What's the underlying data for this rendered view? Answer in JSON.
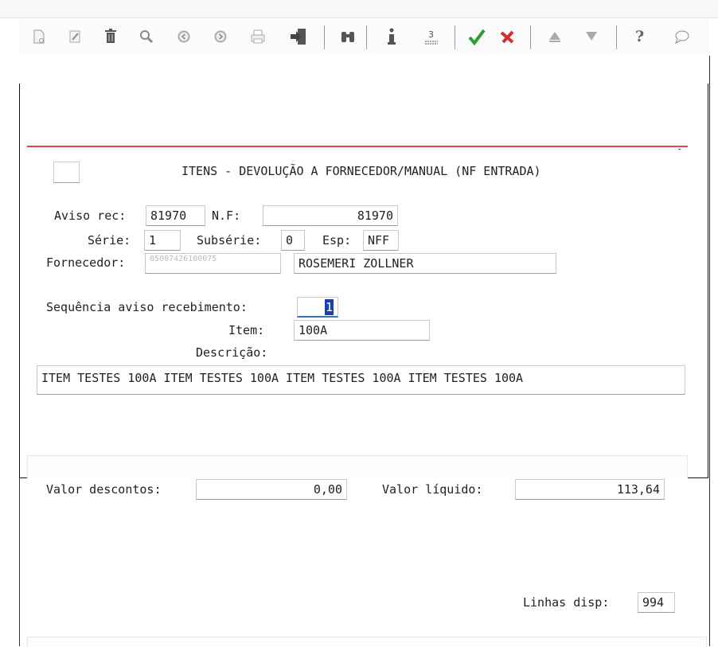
{
  "form": {
    "title": "ITENS - DEVOLUÇÃO A FORNECEDOR/MANUAL (NF ENTRADA)",
    "aviso_rec_label": "Aviso rec:",
    "aviso_rec_value": "81970",
    "nf_label": "N.F:",
    "nf_value": "81970",
    "serie_label": "Série:",
    "serie_value": "1",
    "subserie_label": "Subsérie:",
    "subserie_value": "0",
    "esp_label": "Esp:",
    "esp_value": "NFF",
    "fornecedor_label": "Fornecedor:",
    "fornecedor_code": "05007426100075",
    "fornecedor_name": "ROSEMERI ZOLLNER",
    "sequencia_label": "Sequência aviso recebimento:",
    "sequencia_value": "1",
    "item_label": "Item:",
    "item_value": "100A",
    "descricao_label": "Descrição:",
    "descricao_value": "ITEM TESTES 100A ITEM TESTES 100A ITEM TESTES 100A ITEM TESTES 100A",
    "valor_descontos_label": "Valor descontos:",
    "valor_descontos_value": "0,00",
    "valor_liquido_label": "Valor líquido:",
    "valor_liquido_value": "113,64",
    "linhas_disp_label": "Linhas disp:",
    "linhas_disp_value": "994"
  },
  "toolbar_icons": [
    "new-icon",
    "edit-icon",
    "delete-icon",
    "search-icon",
    "previous-icon",
    "next-icon",
    "print-icon",
    "exit-icon",
    "binoculars-icon",
    "info-icon",
    "list-icon",
    "confirm-icon",
    "cancel-icon",
    "up-icon",
    "down-icon",
    "help-icon",
    "chat-icon"
  ],
  "colors": {
    "confirm": "#2e9e2e",
    "cancel": "#d23030",
    "separator_line": "#e04848",
    "cursor": "#1c3fa8"
  }
}
